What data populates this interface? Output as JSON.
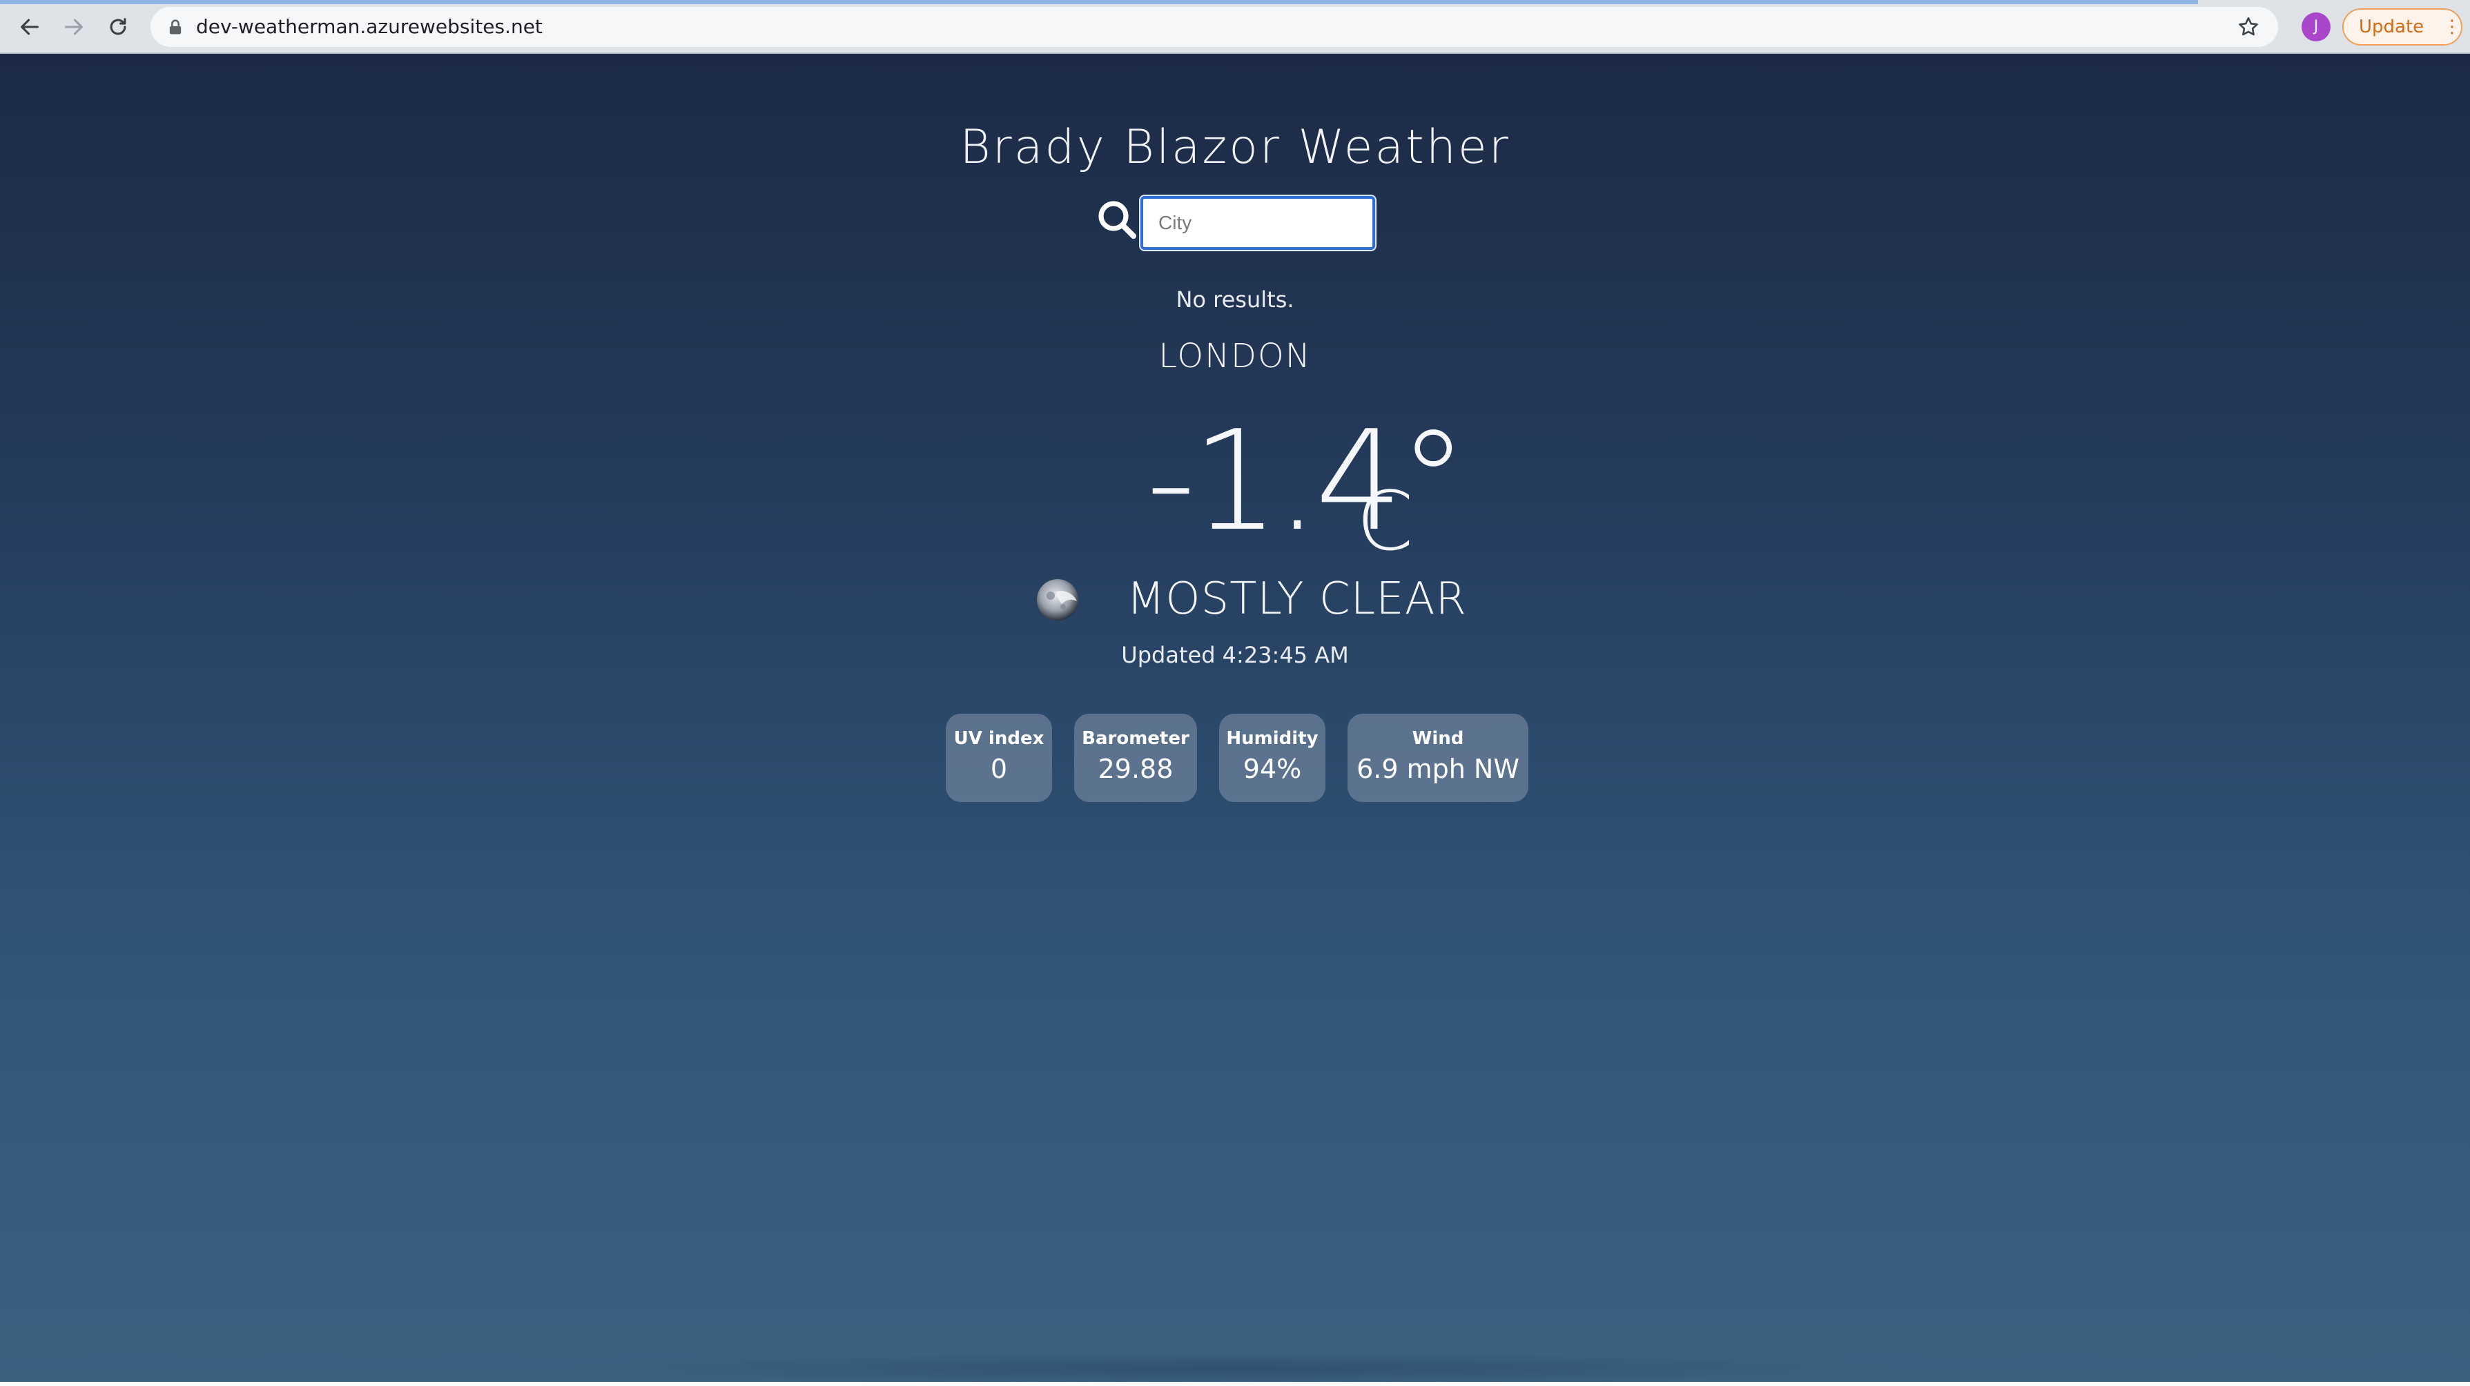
{
  "browser": {
    "url": "dev-weatherman.azurewebsites.net",
    "profile_initial": "J",
    "update_label": "Update",
    "menu_glyph": "⋮",
    "load_progress": 0.89,
    "icons": [
      "back-arrow-icon",
      "forward-arrow-icon",
      "reload-icon",
      "lock-icon",
      "star-icon"
    ]
  },
  "app": {
    "title": "Brady Blazor Weather",
    "search": {
      "placeholder": "City",
      "value": ""
    },
    "no_results": "No results.",
    "city": "LONDON",
    "temperature": "-1.4°",
    "temperature_unit": "C",
    "condition": "MOSTLY CLEAR",
    "condition_icon": "moon-icon",
    "updated": "Updated 4:23:45 AM",
    "stats": [
      {
        "label": "UV index",
        "value": "0"
      },
      {
        "label": "Barometer",
        "value": "29.88"
      },
      {
        "label": "Humidity",
        "value": "94%"
      },
      {
        "label": "Wind",
        "value": "6.9 mph NW"
      }
    ]
  },
  "colors": {
    "background_top": "#1c2a45",
    "background_bottom": "#3b6181",
    "input_focus": "#2f6ed6",
    "update_accent": "#d26b14",
    "avatar": "#a946c9"
  }
}
